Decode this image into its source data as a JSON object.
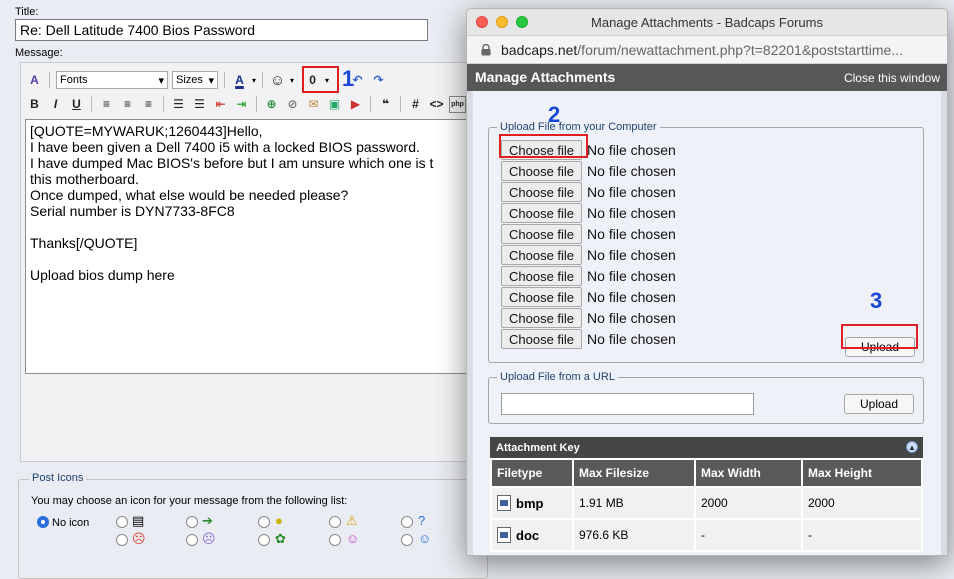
{
  "editor": {
    "title_label": "Title:",
    "title_value": "Re: Dell Latitude 7400 Bios Password",
    "message_label": "Message:",
    "fonts_select": "Fonts",
    "sizes_select": "Sizes",
    "message_text": "[QUOTE=MYWARUK;1260443]Hello,\nI have been given a Dell 7400 i5 with a locked BIOS password.\nI have dumped Mac BIOS's before but I am unsure which one is t\nthis motherboard.\nOnce dumped, what else would be needed please?\nSerial number is DYN7733-8FC8\n\nThanks[/QUOTE]\n\nUpload bios dump here",
    "toolbar_icons": [
      "smilies-icon",
      "attachment-paperclip-icon",
      "undo-icon",
      "redo-icon",
      "bold-icon",
      "italic-icon",
      "underline-icon",
      "align-left-icon",
      "align-center-icon",
      "align-right-icon",
      "ordered-list-icon",
      "unordered-list-icon",
      "outdent-icon",
      "indent-icon",
      "link-icon",
      "unlink-icon",
      "email-link-icon",
      "image-icon",
      "video-icon",
      "quote-icon",
      "code-icon",
      "html-icon",
      "php-icon"
    ]
  },
  "annotations": {
    "step1": "1",
    "step2": "2",
    "step3": "3",
    "highlight_color": "#e02020",
    "number_color": "#1947d6"
  },
  "post_icons": {
    "legend": "Post Icons",
    "description": "You may choose an icon for your message from the following list:",
    "no_icon_label": "No icon",
    "icons": [
      "document-icon",
      "arrow-right-icon",
      "lightbulb-icon",
      "warning-icon",
      "question-icon",
      "angry-face-icon",
      "sad-face-icon",
      "thumbs-up-icon",
      "smile-face-icon",
      "wink-face-icon"
    ]
  },
  "popup": {
    "window_title": "Manage Attachments - Badcaps Forums",
    "url_host": "badcaps.net",
    "url_path": "/forum/newattachment.php?t=82201&poststarttime...",
    "heading": "Manage Attachments",
    "close_link": "Close this window",
    "upload_computer_legend": "Upload File from your Computer",
    "choose_file_label": "Choose file",
    "no_file_label": "No file chosen",
    "file_rows": 10,
    "upload_label": "Upload",
    "upload_url_legend": "Upload File from a URL",
    "url_upload_label": "Upload",
    "key_heading": "Attachment Key",
    "columns": [
      "Filetype",
      "Max Filesize",
      "Max Width",
      "Max Height"
    ],
    "rows": [
      {
        "type": "bmp",
        "size": "1.91 MB",
        "width": "2000",
        "height": "2000"
      },
      {
        "type": "doc",
        "size": "976.6 KB",
        "width": "-",
        "height": "-"
      }
    ]
  }
}
